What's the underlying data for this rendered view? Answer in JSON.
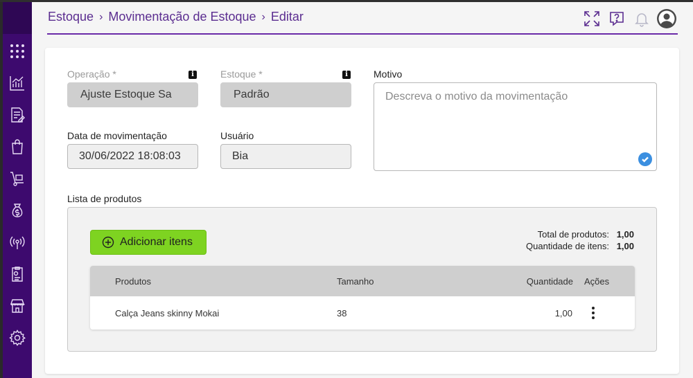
{
  "breadcrumb": [
    {
      "label": "Estoque"
    },
    {
      "label": "Movimentação de Estoque"
    },
    {
      "label": "Editar"
    }
  ],
  "colors": {
    "sidebar": "#3d0a6e",
    "accent": "#5b2d90",
    "add_button": "#7ed321",
    "check_badge": "#3b8fe0"
  },
  "sidebar_icons": [
    "apps-grid-icon",
    "chart-icon",
    "document-edit-icon",
    "shopping-bag-icon",
    "hand-truck-icon",
    "money-bag-icon",
    "broadcast-icon",
    "report-icon",
    "store-icon",
    "settings-gear-icon"
  ],
  "header_icons": [
    "fullscreen-icon",
    "help-chat-icon",
    "notification-bell-icon",
    "user-avatar-icon"
  ],
  "form": {
    "operacao": {
      "label": "Operação *",
      "value": "Ajuste Estoque Sa"
    },
    "estoque": {
      "label": "Estoque *",
      "value": "Padrão"
    },
    "motivo": {
      "label": "Motivo",
      "placeholder": "Descreva o motivo da movimentação"
    },
    "data": {
      "label": "Data de movimentação",
      "value": "30/06/2022 18:08:03"
    },
    "usuario": {
      "label": "Usuário",
      "value": "Bia"
    },
    "info_glyph": "i"
  },
  "products": {
    "section_label": "Lista de produtos",
    "add_button_label": "Adicionar itens",
    "totals": {
      "total_label": "Total de produtos:",
      "total_value": "1,00",
      "qty_label": "Quantidade de itens:",
      "qty_value": "1,00"
    },
    "columns": [
      "Produtos",
      "Tamanho",
      "Quantidade",
      "Ações"
    ],
    "rows": [
      {
        "produto": "Calça Jeans skinny Mokai",
        "tamanho": "38",
        "quantidade": "1,00"
      }
    ]
  }
}
